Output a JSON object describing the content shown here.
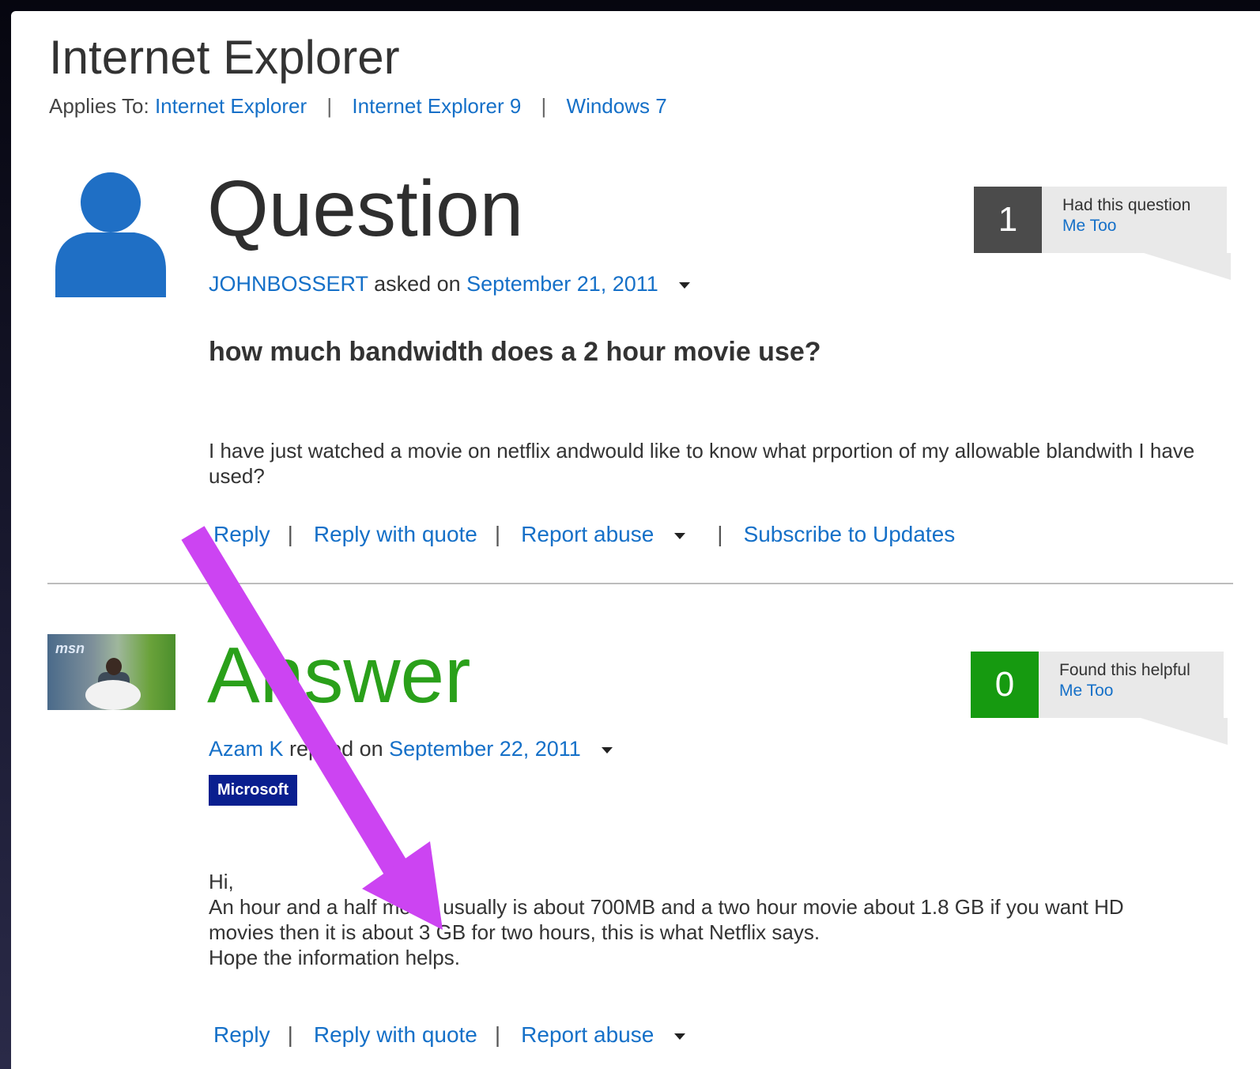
{
  "header": {
    "title": "Internet Explorer",
    "applies_to_label": "Applies To:",
    "applies_to": [
      "Internet Explorer",
      "Internet Explorer 9",
      "Windows 7"
    ]
  },
  "question": {
    "heading": "Question",
    "author": "JOHNBOSSERT",
    "verb": " asked on ",
    "date": "September 21, 2011",
    "title": "how much bandwidth does a 2 hour movie use?",
    "body": "I have just watched a movie on netflix andwould like to know what prportion of my allowable blandwith I have used?",
    "vote_count": "1",
    "vote_label": "Had this question",
    "vote_action": "Me Too",
    "actions": {
      "reply": "Reply",
      "reply_quote": "Reply with quote",
      "report": "Report abuse",
      "subscribe": "Subscribe to Updates"
    }
  },
  "answer": {
    "heading": "Answer",
    "author": "Azam K",
    "verb": " replied on ",
    "date": "September 22, 2011",
    "badge": "Microsoft",
    "avatar_text": "msn",
    "body_lines": [
      "Hi,",
      "An hour and a half movie usually is about 700MB and a two hour movie about 1.8 GB if you want HD",
      "movies then it is about 3 GB for two hours, this is what Netflix says.",
      "Hope the information helps."
    ],
    "vote_count": "0",
    "vote_label": "Found this helpful",
    "vote_action": "Me Too",
    "actions": {
      "reply": "Reply",
      "reply_quote": "Reply with quote",
      "report": "Report abuse"
    }
  },
  "colors": {
    "link": "#1570c8",
    "answer_green": "#2aa01a",
    "question_count_bg": "#4b4b4b",
    "answer_count_bg": "#169a10",
    "badge_bg": "#0a1f8f",
    "annotation_arrow": "#cc44f2"
  },
  "icons": [
    "user-avatar-icon",
    "caret-down-icon",
    "annotation-arrow"
  ]
}
